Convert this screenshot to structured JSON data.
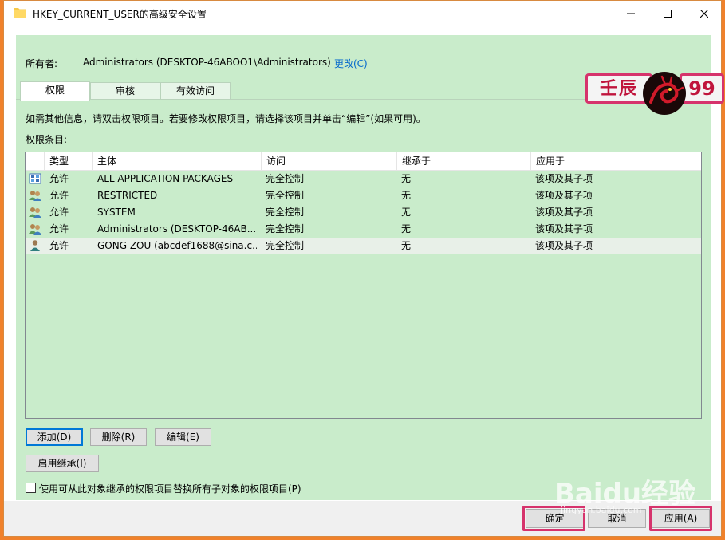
{
  "window": {
    "title": "HKEY_CURRENT_USER的高级安全设置"
  },
  "owner": {
    "label": "所有者:",
    "value": "Administrators (DESKTOP-46ABOO1\\Administrators)",
    "change_link": "更改(C)"
  },
  "tabs": [
    {
      "label": "权限",
      "active": true
    },
    {
      "label": "审核",
      "active": false
    },
    {
      "label": "有效访问",
      "active": false
    }
  ],
  "info_text": "如需其他信息，请双击权限项目。若要修改权限项目，请选择该项目并单击“编辑”(如果可用)。",
  "list_title": "权限条目:",
  "columns": [
    "类型",
    "主体",
    "访问",
    "继承于",
    "应用于"
  ],
  "rows": [
    {
      "icon": "app-packages-icon",
      "type": "允许",
      "principal": "ALL APPLICATION PACKAGES",
      "access": "完全控制",
      "inherited": "无",
      "applies": "该项及其子项"
    },
    {
      "icon": "group-icon",
      "type": "允许",
      "principal": "RESTRICTED",
      "access": "完全控制",
      "inherited": "无",
      "applies": "该项及其子项"
    },
    {
      "icon": "group-icon",
      "type": "允许",
      "principal": "SYSTEM",
      "access": "完全控制",
      "inherited": "无",
      "applies": "该项及其子项"
    },
    {
      "icon": "group-icon",
      "type": "允许",
      "principal": "Administrators (DESKTOP-46AB...",
      "access": "完全控制",
      "inherited": "无",
      "applies": "该项及其子项"
    },
    {
      "icon": "user-icon",
      "type": "允许",
      "principal": "GONG ZOU (abcdef1688@sina.c...",
      "access": "完全控制",
      "inherited": "无",
      "applies": "该项及其子项"
    }
  ],
  "buttons": {
    "add": "添加(D)",
    "remove": "删除(R)",
    "edit": "编辑(E)",
    "enable_inheritance": "启用继承(I)"
  },
  "checkbox_label": "使用可从此对象继承的权限项目替换所有子对象的权限项目(P)",
  "footer": {
    "ok": "确定",
    "cancel": "取消",
    "apply": "应用(A)"
  },
  "logo": {
    "left_text": "壬辰",
    "right_text": "99"
  },
  "watermark": {
    "brand": "Baidu经验",
    "url": "jingyan.baidu.com"
  },
  "colors": {
    "pane_green": "#c9eccb",
    "highlight": "#d6336c",
    "link": "#0066cc"
  }
}
